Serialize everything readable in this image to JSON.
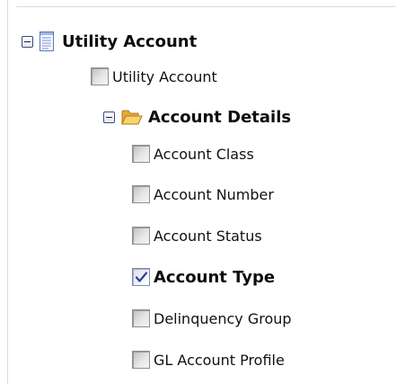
{
  "tree": {
    "root": {
      "label": "Utility Account",
      "icon": "document-icon",
      "expanded": true,
      "children": [
        {
          "label": "Utility Account",
          "checked": false
        }
      ]
    },
    "group": {
      "label": "Account Details",
      "icon": "folder-open-icon",
      "expanded": true,
      "fields": [
        {
          "label": "Account Class",
          "checked": false
        },
        {
          "label": "Account Number",
          "checked": false
        },
        {
          "label": "Account Status",
          "checked": false
        },
        {
          "label": "Account Type",
          "checked": true
        },
        {
          "label": "Delinquency Group",
          "checked": false
        },
        {
          "label": "GL Account Profile",
          "checked": false
        }
      ]
    }
  },
  "colors": {
    "check_mark": "#2b3f9a",
    "folder": "#f2c14e"
  }
}
